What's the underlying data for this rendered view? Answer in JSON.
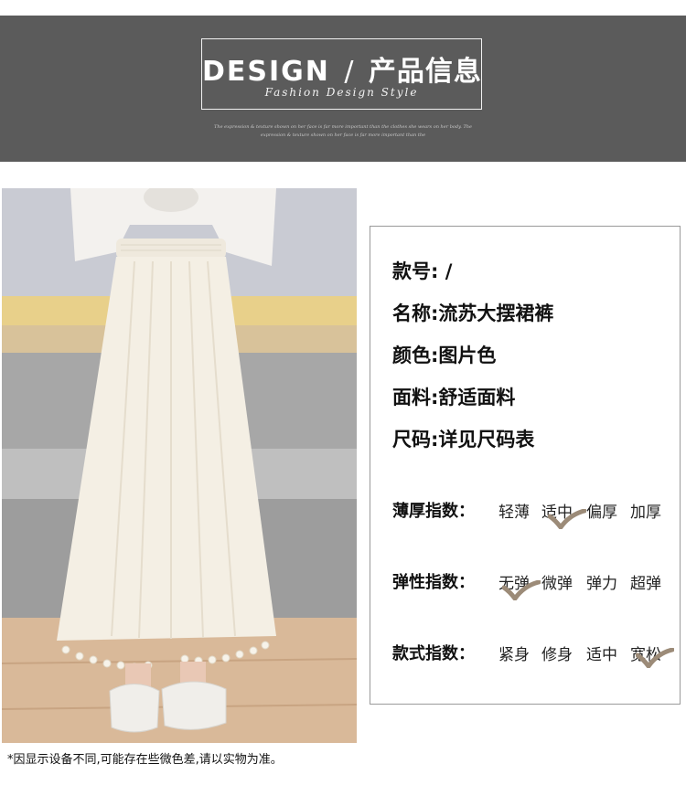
{
  "header": {
    "title_en": "DESIGN",
    "separator": "/",
    "title_cn": "产品信息",
    "subtitle": "Fashion Design Style",
    "tiny_line_1": "The expression & texture shown on her face is far more important than the clothes she wears on her body. The",
    "tiny_line_2": "expression & texture shown on her face is far more important than the"
  },
  "info": [
    {
      "label": "款号:",
      "value": "/"
    },
    {
      "label": "名称:",
      "value": "流苏大摆裙裤"
    },
    {
      "label": "颜色:",
      "value": "图片色"
    },
    {
      "label": "面料:",
      "value": "舒适面料"
    },
    {
      "label": "尺码:",
      "value": "详见尺码表"
    }
  ],
  "indices": [
    {
      "label": "薄厚指数：",
      "options": [
        "轻薄",
        "适中",
        "偏厚",
        "加厚"
      ],
      "selected": 1
    },
    {
      "label": "弹性指数：",
      "options": [
        "无弹",
        "微弹",
        "弹力",
        "超弹"
      ],
      "selected": 0
    },
    {
      "label": "款式指数：",
      "options": [
        "紧身",
        "修身",
        "适中",
        "宽松"
      ],
      "selected": 3
    }
  ],
  "check_color": "#9c8b78",
  "header_color": "#5b5b5b",
  "footnote": "*因显示设备不同,可能存在些微色差,请以实物为准。"
}
